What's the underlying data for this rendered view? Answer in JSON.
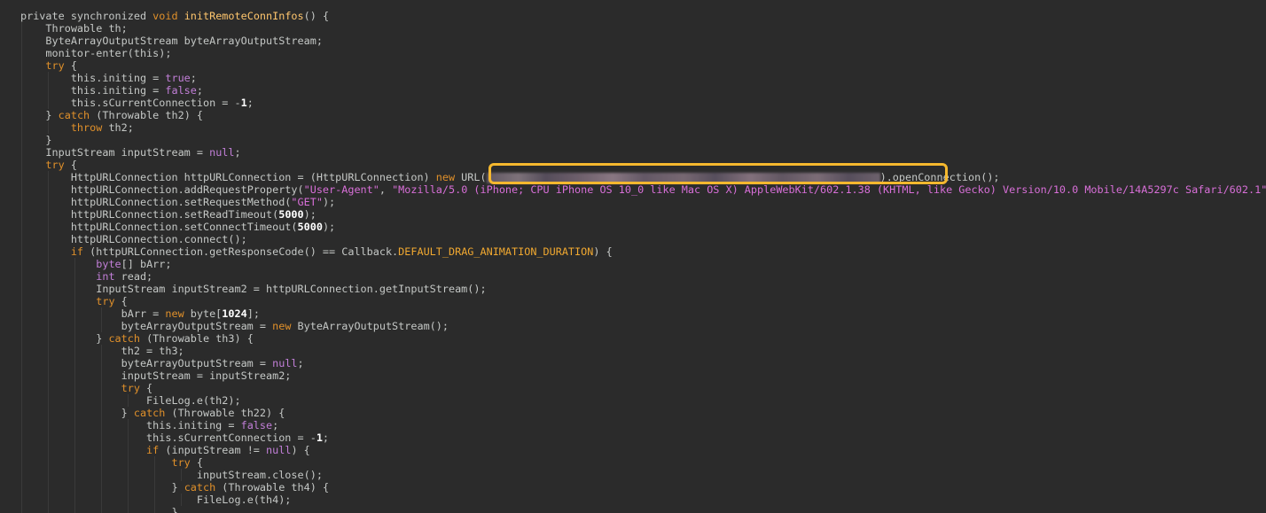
{
  "editor": {
    "highlight_color": "#f5b82e",
    "background": "#2b2b2b",
    "lines": [
      {
        "indent": 0,
        "tokens": [
          {
            "t": "plain",
            "v": "private synchronized "
          },
          {
            "t": "kw",
            "v": "void"
          },
          {
            "t": "plain",
            "v": " "
          },
          {
            "t": "fn",
            "v": "initRemoteConnInfos"
          },
          {
            "t": "plain",
            "v": "() {"
          }
        ]
      },
      {
        "indent": 1,
        "tokens": [
          {
            "t": "plain",
            "v": "Throwable th;"
          }
        ]
      },
      {
        "indent": 1,
        "tokens": [
          {
            "t": "plain",
            "v": "ByteArrayOutputStream byteArrayOutputStream;"
          }
        ]
      },
      {
        "indent": 1,
        "tokens": [
          {
            "t": "plain",
            "v": "monitor-enter(this);"
          }
        ]
      },
      {
        "indent": 1,
        "tokens": [
          {
            "t": "kw",
            "v": "try"
          },
          {
            "t": "plain",
            "v": " {"
          }
        ]
      },
      {
        "indent": 2,
        "tokens": [
          {
            "t": "plain",
            "v": "this.initing = "
          },
          {
            "t": "lit",
            "v": "true"
          },
          {
            "t": "plain",
            "v": ";"
          }
        ]
      },
      {
        "indent": 2,
        "tokens": [
          {
            "t": "plain",
            "v": "this.initing = "
          },
          {
            "t": "lit",
            "v": "false"
          },
          {
            "t": "plain",
            "v": ";"
          }
        ]
      },
      {
        "indent": 2,
        "tokens": [
          {
            "t": "plain",
            "v": "this.sCurrentConnection = -"
          },
          {
            "t": "num",
            "v": "1"
          },
          {
            "t": "plain",
            "v": ";"
          }
        ]
      },
      {
        "indent": 1,
        "tokens": [
          {
            "t": "plain",
            "v": "} "
          },
          {
            "t": "kw",
            "v": "catch"
          },
          {
            "t": "plain",
            "v": " (Throwable th2) {"
          }
        ]
      },
      {
        "indent": 2,
        "tokens": [
          {
            "t": "kw",
            "v": "throw"
          },
          {
            "t": "plain",
            "v": " th2;"
          }
        ]
      },
      {
        "indent": 1,
        "tokens": [
          {
            "t": "plain",
            "v": "}"
          }
        ]
      },
      {
        "indent": 1,
        "tokens": [
          {
            "t": "plain",
            "v": "InputStream inputStream = "
          },
          {
            "t": "lit",
            "v": "null"
          },
          {
            "t": "plain",
            "v": ";"
          }
        ]
      },
      {
        "indent": 1,
        "tokens": [
          {
            "t": "kw",
            "v": "try"
          },
          {
            "t": "plain",
            "v": " {"
          }
        ]
      },
      {
        "indent": 2,
        "tokens": [
          {
            "t": "plain",
            "v": "HttpURLConnection httpURLConnection = (HttpURLConnection) "
          },
          {
            "t": "kw",
            "v": "new"
          },
          {
            "t": "plain",
            "v": " URL("
          },
          {
            "t": "blur",
            "v": ""
          },
          {
            "t": "plain",
            "v": ").openConnection();"
          }
        ]
      },
      {
        "indent": 2,
        "tokens": [
          {
            "t": "plain",
            "v": "httpURLConnection.addRequestProperty("
          },
          {
            "t": "str",
            "v": "\"User-Agent\""
          },
          {
            "t": "plain",
            "v": ", "
          },
          {
            "t": "str",
            "v": "\"Mozilla/5.0 (iPhone; CPU iPhone OS 10_0 like Mac OS X) AppleWebKit/602.1.38 (KHTML, like Gecko) Version/10.0 Mobile/14A5297c Safari/602.1\""
          },
          {
            "t": "plain",
            "v": ");"
          }
        ]
      },
      {
        "indent": 2,
        "tokens": [
          {
            "t": "plain",
            "v": "httpURLConnection.setRequestMethod("
          },
          {
            "t": "str",
            "v": "\"GET\""
          },
          {
            "t": "plain",
            "v": ");"
          }
        ]
      },
      {
        "indent": 2,
        "tokens": [
          {
            "t": "plain",
            "v": "httpURLConnection.setReadTimeout("
          },
          {
            "t": "num",
            "v": "5000"
          },
          {
            "t": "plain",
            "v": ");"
          }
        ]
      },
      {
        "indent": 2,
        "tokens": [
          {
            "t": "plain",
            "v": "httpURLConnection.setConnectTimeout("
          },
          {
            "t": "num",
            "v": "5000"
          },
          {
            "t": "plain",
            "v": ");"
          }
        ]
      },
      {
        "indent": 2,
        "tokens": [
          {
            "t": "plain",
            "v": "httpURLConnection.connect();"
          }
        ]
      },
      {
        "indent": 2,
        "tokens": [
          {
            "t": "kw",
            "v": "if"
          },
          {
            "t": "plain",
            "v": " (httpURLConnection.getResponseCode() == Callback."
          },
          {
            "t": "const",
            "v": "DEFAULT_DRAG_ANIMATION_DURATION"
          },
          {
            "t": "plain",
            "v": ") {"
          }
        ]
      },
      {
        "indent": 3,
        "tokens": [
          {
            "t": "lit",
            "v": "byte"
          },
          {
            "t": "plain",
            "v": "[] bArr;"
          }
        ]
      },
      {
        "indent": 3,
        "tokens": [
          {
            "t": "lit",
            "v": "int"
          },
          {
            "t": "plain",
            "v": " read;"
          }
        ]
      },
      {
        "indent": 3,
        "tokens": [
          {
            "t": "plain",
            "v": "InputStream inputStream2 = httpURLConnection.getInputStream();"
          }
        ]
      },
      {
        "indent": 3,
        "tokens": [
          {
            "t": "kw",
            "v": "try"
          },
          {
            "t": "plain",
            "v": " {"
          }
        ]
      },
      {
        "indent": 4,
        "tokens": [
          {
            "t": "plain",
            "v": "bArr = "
          },
          {
            "t": "kw",
            "v": "new"
          },
          {
            "t": "plain",
            "v": " byte["
          },
          {
            "t": "num",
            "v": "1024"
          },
          {
            "t": "plain",
            "v": "];"
          }
        ]
      },
      {
        "indent": 4,
        "tokens": [
          {
            "t": "plain",
            "v": "byteArrayOutputStream = "
          },
          {
            "t": "kw",
            "v": "new"
          },
          {
            "t": "plain",
            "v": " ByteArrayOutputStream();"
          }
        ]
      },
      {
        "indent": 3,
        "tokens": [
          {
            "t": "plain",
            "v": "} "
          },
          {
            "t": "kw",
            "v": "catch"
          },
          {
            "t": "plain",
            "v": " (Throwable th3) {"
          }
        ]
      },
      {
        "indent": 4,
        "tokens": [
          {
            "t": "plain",
            "v": "th2 = th3;"
          }
        ]
      },
      {
        "indent": 4,
        "tokens": [
          {
            "t": "plain",
            "v": "byteArrayOutputStream = "
          },
          {
            "t": "lit",
            "v": "null"
          },
          {
            "t": "plain",
            "v": ";"
          }
        ]
      },
      {
        "indent": 4,
        "tokens": [
          {
            "t": "plain",
            "v": "inputStream = inputStream2;"
          }
        ]
      },
      {
        "indent": 4,
        "tokens": [
          {
            "t": "kw",
            "v": "try"
          },
          {
            "t": "plain",
            "v": " {"
          }
        ]
      },
      {
        "indent": 5,
        "tokens": [
          {
            "t": "plain",
            "v": "FileLog.e(th2);"
          }
        ]
      },
      {
        "indent": 4,
        "tokens": [
          {
            "t": "plain",
            "v": "} "
          },
          {
            "t": "kw",
            "v": "catch"
          },
          {
            "t": "plain",
            "v": " (Throwable th22) {"
          }
        ]
      },
      {
        "indent": 5,
        "tokens": [
          {
            "t": "plain",
            "v": "this.initing = "
          },
          {
            "t": "lit",
            "v": "false"
          },
          {
            "t": "plain",
            "v": ";"
          }
        ]
      },
      {
        "indent": 5,
        "tokens": [
          {
            "t": "plain",
            "v": "this.sCurrentConnection = -"
          },
          {
            "t": "num",
            "v": "1"
          },
          {
            "t": "plain",
            "v": ";"
          }
        ]
      },
      {
        "indent": 5,
        "tokens": [
          {
            "t": "kw",
            "v": "if"
          },
          {
            "t": "plain",
            "v": " (inputStream != "
          },
          {
            "t": "lit",
            "v": "null"
          },
          {
            "t": "plain",
            "v": ") {"
          }
        ]
      },
      {
        "indent": 6,
        "tokens": [
          {
            "t": "kw",
            "v": "try"
          },
          {
            "t": "plain",
            "v": " {"
          }
        ]
      },
      {
        "indent": 7,
        "tokens": [
          {
            "t": "plain",
            "v": "inputStream.close();"
          }
        ]
      },
      {
        "indent": 6,
        "tokens": [
          {
            "t": "plain",
            "v": "} "
          },
          {
            "t": "kw",
            "v": "catch"
          },
          {
            "t": "plain",
            "v": " (Throwable th4) {"
          }
        ]
      },
      {
        "indent": 7,
        "tokens": [
          {
            "t": "plain",
            "v": "FileLog.e(th4);"
          }
        ]
      },
      {
        "indent": 6,
        "tokens": [
          {
            "t": "plain",
            "v": "}"
          }
        ]
      }
    ]
  }
}
